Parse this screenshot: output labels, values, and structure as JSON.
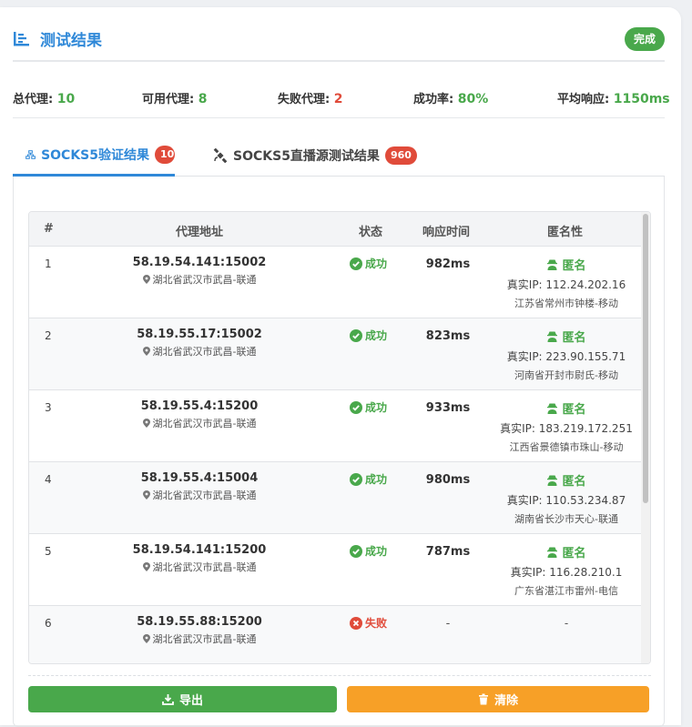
{
  "header": {
    "title": "测试结果",
    "status_badge": "完成"
  },
  "stats": {
    "total_label": "总代理:",
    "total_value": "10",
    "available_label": "可用代理:",
    "available_value": "8",
    "failed_label": "失败代理:",
    "failed_value": "2",
    "rate_label": "成功率:",
    "rate_value": "80%",
    "avg_label": "平均响应:",
    "avg_value": "1150ms"
  },
  "tabs": [
    {
      "label": "SOCKS5验证结果",
      "count": "10",
      "active": true
    },
    {
      "label": "SOCKS5直播源测试结果",
      "count": "960",
      "active": false
    }
  ],
  "table": {
    "headers": {
      "num": "#",
      "addr": "代理地址",
      "status": "状态",
      "time": "响应时间",
      "anon": "匿名性"
    },
    "rows": [
      {
        "num": "1",
        "addr": "58.19.54.141:15002",
        "loc": "湖北省武汉市武昌-联通",
        "status": "成功",
        "ok": true,
        "time": "982ms",
        "anon": "匿名",
        "realip": "真实IP: 112.24.202.16",
        "iploc": "江苏省常州市钟楼-移动"
      },
      {
        "num": "2",
        "addr": "58.19.55.17:15002",
        "loc": "湖北省武汉市武昌-联通",
        "status": "成功",
        "ok": true,
        "time": "823ms",
        "anon": "匿名",
        "realip": "真实IP: 223.90.155.71",
        "iploc": "河南省开封市尉氏-移动"
      },
      {
        "num": "3",
        "addr": "58.19.55.4:15200",
        "loc": "湖北省武汉市武昌-联通",
        "status": "成功",
        "ok": true,
        "time": "933ms",
        "anon": "匿名",
        "realip": "真实IP: 183.219.172.251",
        "iploc": "江西省景德镇市珠山-移动"
      },
      {
        "num": "4",
        "addr": "58.19.55.4:15004",
        "loc": "湖北省武汉市武昌-联通",
        "status": "成功",
        "ok": true,
        "time": "980ms",
        "anon": "匿名",
        "realip": "真实IP: 110.53.234.87",
        "iploc": "湖南省长沙市天心-联通"
      },
      {
        "num": "5",
        "addr": "58.19.54.141:15200",
        "loc": "湖北省武汉市武昌-联通",
        "status": "成功",
        "ok": true,
        "time": "787ms",
        "anon": "匿名",
        "realip": "真实IP: 116.28.210.1",
        "iploc": "广东省湛江市雷州-电信"
      },
      {
        "num": "6",
        "addr": "58.19.55.88:15200",
        "loc": "湖北省武汉市武昌-联通",
        "status": "失败",
        "ok": false,
        "time": "-",
        "anon": "-",
        "realip": "",
        "iploc": ""
      }
    ]
  },
  "actions": {
    "export_label": "导出",
    "clear_label": "清除"
  },
  "colors": {
    "accent": "#2f88d8",
    "success": "#49a84b",
    "danger": "#e04b3a",
    "warning": "#f7a027"
  }
}
